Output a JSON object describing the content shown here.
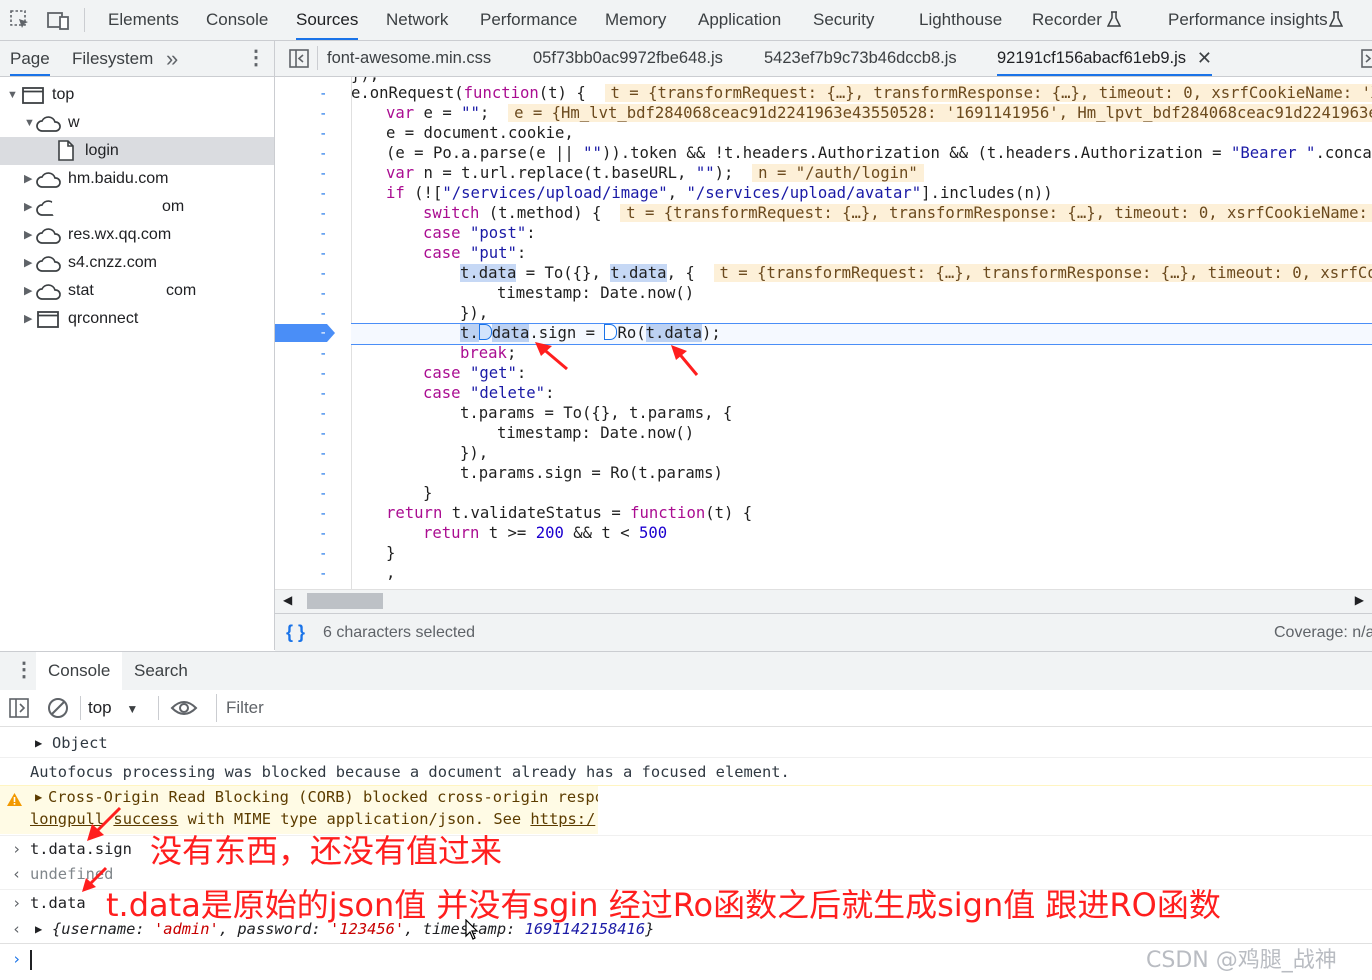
{
  "toolbar": {
    "tabs": [
      "Elements",
      "Console",
      "Sources",
      "Network",
      "Performance",
      "Memory",
      "Application",
      "Security",
      "Lighthouse",
      "Recorder",
      "Performance insights"
    ],
    "active": "Sources"
  },
  "navigator": {
    "tabs": [
      "Page",
      "Filesystem"
    ],
    "more": "»",
    "tree": [
      {
        "label": "top"
      },
      {
        "label": "w"
      },
      {
        "label": "login"
      },
      {
        "label": "hm.baidu.com"
      },
      {
        "label": "om"
      },
      {
        "label": "res.wx.qq.com"
      },
      {
        "label": "s4.cnzz.com"
      },
      {
        "label": "stat"
      },
      {
        "label": "com"
      },
      {
        "label": "qrconnect"
      }
    ]
  },
  "editor_tabs": [
    "font-awesome.min.css",
    "05f73bb0ac9972fbe648.js",
    "5423ef7b9c73b46dccb8.js",
    "92191cf156abacf61eb9.js"
  ],
  "code": {
    "l0": "}),",
    "l1_a": "e.onRequest(",
    "l1_b": "function",
    "l1_c": "(t) {",
    "l1_inl": "t = {transformRequest: {…}, transformResponse: {…}, timeout: 0, xsrfCookieName: 'XSRF",
    "l2_a": "var",
    "l2_b": " e = ",
    "l2_c": "\"\"",
    "l2_d": ";",
    "l2_inl": "e = {Hm_lvt_bdf284068ceac91d2241963e43550528: '1691141956', Hm_lpvt_bdf284068ceac91d2241963e43",
    "l3": "e = document.cookie,",
    "l4_a": "(e = Po.a.parse(e || ",
    "l4_b": "\"\"",
    "l4_c": ")).token && !t.headers.Authorization && (t.headers.Authorization = ",
    "l4_d": "\"Bearer \"",
    "l4_e": ".concat(",
    "l5_a": "var",
    "l5_b": " n = t.url.replace(t.baseURL, ",
    "l5_c": "\"\"",
    "l5_d": ");",
    "l5_inl": "n = \"/auth/login\"",
    "l6_a": "if",
    "l6_b": " (![",
    "l6_c": "\"/services/upload/image\"",
    "l6_d": ", ",
    "l6_e": "\"/services/upload/avatar\"",
    "l6_f": "].includes(n))",
    "l7_a": "switch",
    "l7_b": " (t.method) {",
    "l7_inl": "t = {transformRequest: {…}, transformResponse: {…}, timeout: 0, xsrfCookieName: 'X",
    "l8_a": "case",
    "l8_b": "\"post\"",
    "l9_a": "case",
    "l9_b": "\"put\"",
    "l10_a": "t.data",
    "l10_b": " = To({}, ",
    "l10_c": "t.data",
    "l10_d": ", {",
    "l10_inl": "t = {transformRequest: {…}, transformResponse: {…}, timeout: 0, xsrfCook",
    "l11": "timestamp: Date.now()",
    "l12": "}),",
    "l13_a": "t.",
    "l13_b": "data",
    "l13_c": ".sign = ",
    "l13_d": "Ro(",
    "l13_e": "t.data",
    "l13_f": ");",
    "l14_a": "break",
    "l14_b": ";",
    "l15_a": "case",
    "l15_b": "\"get\"",
    "l16_a": "case",
    "l16_b": "\"delete\"",
    "l17": "t.params = To({}, t.params, {",
    "l18": "timestamp: Date.now()",
    "l19": "}),",
    "l20": "t.params.sign = Ro(t.params)",
    "l21": "}",
    "l22_a": "return",
    "l22_b": " t.validateStatus = ",
    "l22_c": "function",
    "l22_d": "(t) {",
    "l23_a": "return",
    "l23_b": " t >= ",
    "l23_c": "200",
    "l23_d": " && t < ",
    "l23_e": "500",
    "l24": "}",
    "l25": ","
  },
  "status": {
    "selected": "6 characters selected",
    "coverage": "Coverage: n/a"
  },
  "drawer": {
    "tabs": [
      "Console",
      "Search"
    ],
    "context": "top",
    "filter_placeholder": "Filter"
  },
  "console": {
    "object": "Object",
    "autofocus": "Autofocus processing was blocked because a document already has a focused element.",
    "corb_a": "Cross-Origin Read Blocking (CORB) blocked cross-origin respo",
    "corb_b": "longpull",
    "corb_c": "success",
    "corb_d": " with MIME type application/json. See ",
    "corb_e": "https:/",
    "cmd1": "t.data.sign",
    "res1": "undefined",
    "cmd2": "t.data",
    "res2_a": "{username: ",
    "res2_b": "'admin'",
    "res2_c": ", password: ",
    "res2_d": "'123456'",
    "res2_e": ", timestamp: ",
    "res2_f": "1691142158416",
    "res2_g": "}"
  },
  "annotations": {
    "note1": "没有东西，还没有值过来",
    "note2": "t.data是原始的json值  并没有sgin 经过Ro函数之后就生成sign值 跟进RO函数"
  },
  "watermark": "CSDN @鸡腿_战神",
  "colors": {
    "accent": "#1a73e8",
    "annotation": "#ff1e1e",
    "inline_value_bg": "#fdf0d8"
  }
}
